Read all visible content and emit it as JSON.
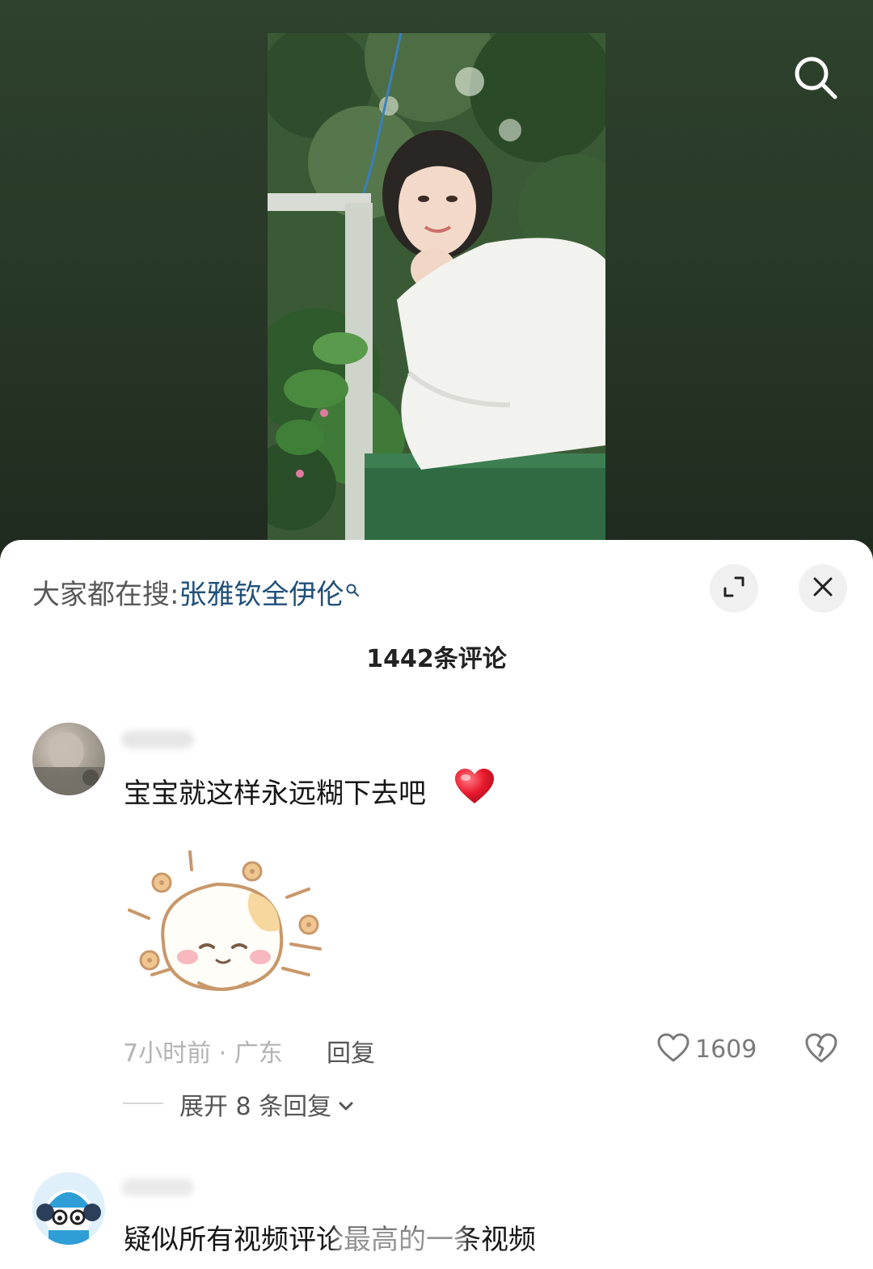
{
  "hot_search": {
    "prefix": "大家都在搜:",
    "term": "张雅钦全伊伦"
  },
  "comments_header": {
    "count_label": "1442条评论"
  },
  "comments": [
    {
      "text": "宝宝就这样永远糊下去吧",
      "emoji": "red-heart",
      "sticker": "cute-smiling-bun-sticker",
      "meta": "7小时前 · 广东",
      "reply_label": "回复",
      "likes": "1609",
      "expand_replies": "展开 8 条回复"
    },
    {
      "text": "疑似所有视频评论最高的一条视频"
    }
  ],
  "icons": {
    "search": "search-icon",
    "expand": "expand-icon",
    "close": "close-icon",
    "like": "heart-outline-icon",
    "dislike": "broken-heart-icon",
    "chevron": "chevron-down-icon"
  },
  "colors": {
    "video_bg": "#283927",
    "hot_term": "#1f4f79",
    "heart_red": "#e8192c"
  }
}
